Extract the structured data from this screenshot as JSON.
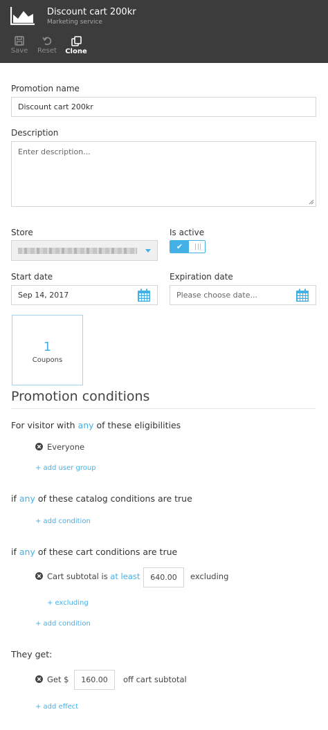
{
  "header": {
    "title": "Discount cart 200kr",
    "subtitle": "Marketing service",
    "toolbar": {
      "save_label": "Save",
      "reset_label": "Reset",
      "clone_label": "Clone"
    }
  },
  "form": {
    "promotion_name_label": "Promotion name",
    "promotion_name_value": "Discount cart 200kr",
    "description_label": "Description",
    "description_placeholder": "Enter description...",
    "store_label": "Store",
    "is_active_label": "Is active",
    "is_active_value": true,
    "start_date_label": "Start date",
    "start_date_value": "Sep 14, 2017",
    "expiration_date_label": "Expiration date",
    "expiration_date_placeholder": "Please choose date..."
  },
  "coupons": {
    "count": "1",
    "label": "Coupons"
  },
  "conditions": {
    "title": "Promotion conditions",
    "eligibility": {
      "prefix": "For visitor with",
      "link": "any",
      "suffix": "of these eligibilities",
      "items": [
        "Everyone"
      ],
      "add_label": "+ add user group"
    },
    "catalog": {
      "prefix": "if",
      "link": "any",
      "suffix": "of these catalog conditions are true",
      "add_label": "+ add condition"
    },
    "cart": {
      "prefix": "if",
      "link": "any",
      "suffix": "of these cart conditions are true",
      "rule_prefix": "Cart subtotal is",
      "rule_link": "at least",
      "rule_value": "640.00",
      "rule_suffix": "excluding",
      "add_excluding_label": "+ excluding",
      "add_label": "+ add condition"
    },
    "effects": {
      "title": "They get:",
      "rule_prefix": "Get $",
      "rule_value": "160.00",
      "rule_suffix": "off cart subtotal",
      "add_label": "+ add effect"
    }
  },
  "colors": {
    "header_bg": "#3c3c3c",
    "accent": "#43b0e6",
    "border": "#d5d5d5"
  }
}
